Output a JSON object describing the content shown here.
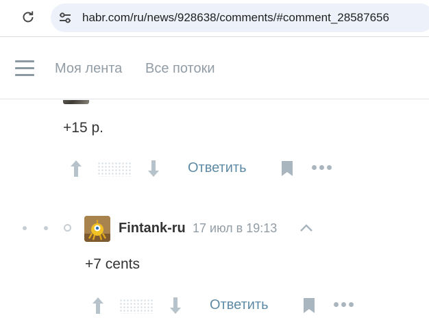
{
  "browser": {
    "url": "habr.com/ru/news/928638/comments/#comment_28587656"
  },
  "header": {
    "nav": [
      {
        "label": "Моя лента"
      },
      {
        "label": "Все потоки"
      }
    ]
  },
  "comments": [
    {
      "text": "+15 р.",
      "reply_label": "Ответить"
    },
    {
      "author": "Fintank-ru",
      "timestamp": "17 июл в 19:13",
      "text": "+7 cents",
      "reply_label": "Ответить"
    }
  ],
  "colors": {
    "accent_link": "#5e8aa5",
    "icon_gray": "#aab6bf",
    "nav_gray": "#929ca5"
  }
}
